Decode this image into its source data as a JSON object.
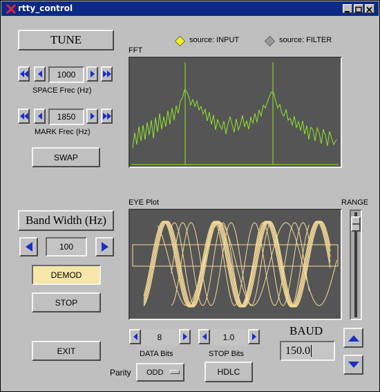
{
  "window": {
    "title": "rtty_control"
  },
  "tune": {
    "label": "TUNE"
  },
  "space": {
    "value": "1000",
    "label": "SPACE Frec (Hz)"
  },
  "mark": {
    "value": "1850",
    "label": "MARK Frec (Hz)"
  },
  "swap": {
    "label": "SWAP"
  },
  "source": {
    "input_label": "source: INPUT",
    "filter_label": "source: FILTER",
    "selected": "INPUT"
  },
  "fft": {
    "title": "FFT"
  },
  "bandwidth": {
    "label": "Band Width (Hz)",
    "value": "100"
  },
  "demod": {
    "label": "DEMOD"
  },
  "stop": {
    "label": "STOP"
  },
  "exit": {
    "label": "EXIT"
  },
  "eye": {
    "title": "EYE Plot"
  },
  "range": {
    "label": "RANGE"
  },
  "data_bits": {
    "value": "8",
    "label": "DATA Bits"
  },
  "stop_bits": {
    "value": "1.0",
    "label": "STOP Bits"
  },
  "baud": {
    "label": "BAUD",
    "value": "150.0"
  },
  "parity": {
    "label": "Parity",
    "value": "ODD"
  },
  "hdlc": {
    "label": "HDLC"
  },
  "colors": {
    "titlebar": "#0b2a86",
    "arrow_blue": "#1a2fc8",
    "plot_bg": "#555555",
    "fft_trace": "#8ee62a",
    "eye_trace": "#f7dc9a",
    "demod_active": "#f6e7a8"
  }
}
